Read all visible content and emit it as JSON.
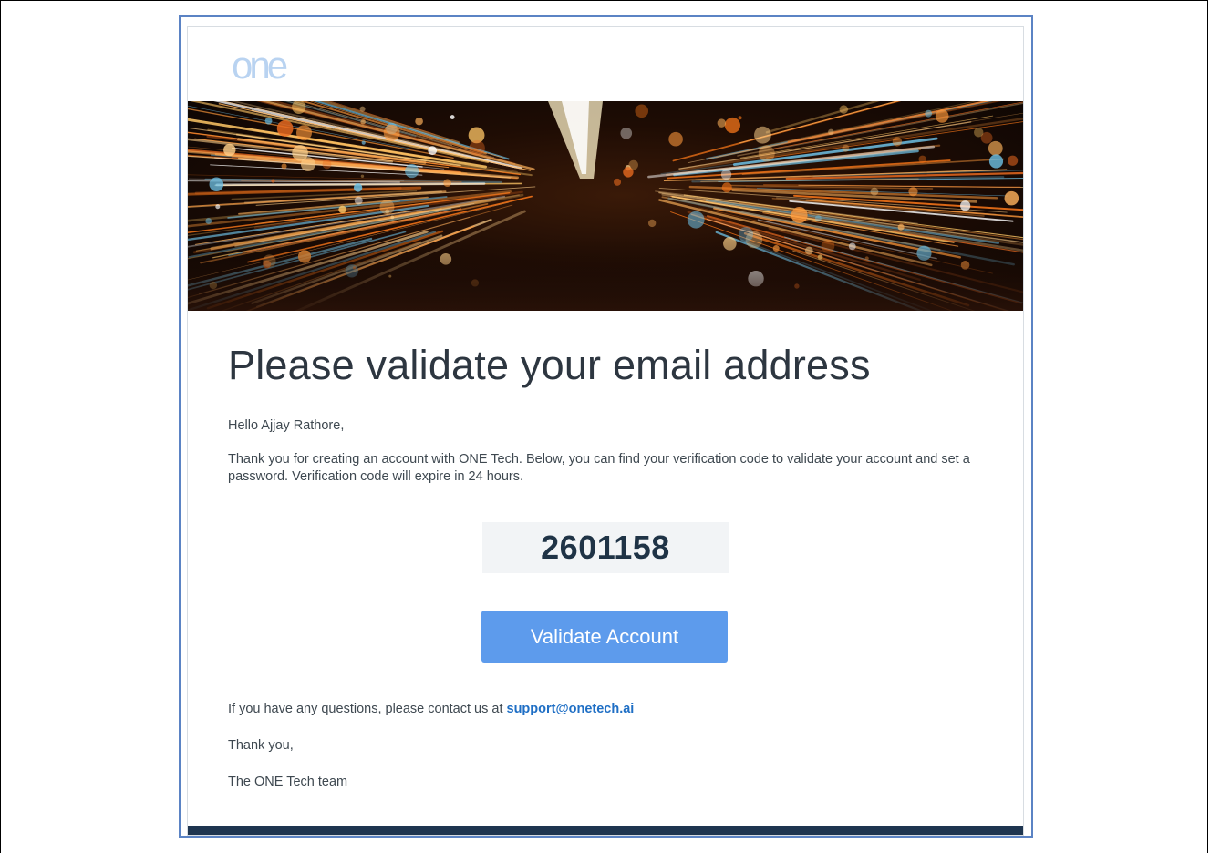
{
  "email": {
    "logo_text": "one",
    "heading": "Please validate your email address",
    "greeting": "Hello Ajjay Rathore,",
    "intro": "Thank you for creating an account with ONE Tech. Below, you can find your verification code to validate your account and set a password. Verification code will expire in 24 hours.",
    "verification_code": "2601158",
    "validate_button_label": "Validate Account",
    "contact_prefix": "If you have any questions, please contact us at ",
    "contact_email": "support@onetech.ai",
    "thanks": "Thank you,",
    "signoff": "The ONE Tech team"
  },
  "icons": {
    "logo": "one-logo",
    "hero": "light-streaks-image"
  },
  "colors": {
    "button": "#5d9bec",
    "code_text": "#1f3346",
    "link": "#1f6fc5",
    "footer": "#1e3550",
    "logo": "#b9d3f1"
  }
}
